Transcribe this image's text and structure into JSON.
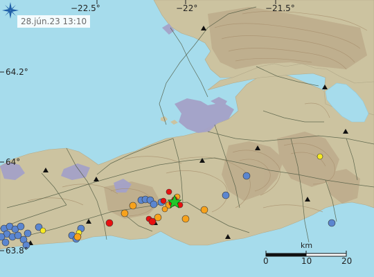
{
  "timestamp": "28.jún.23  13:10",
  "lon_labels": [
    "−22.5°",
    "−22°",
    "−21.5°"
  ],
  "lat_labels": [
    "64.2°",
    "64°",
    "63.8°"
  ],
  "scale": {
    "unit": "km",
    "ticks": [
      "0",
      "10",
      "20"
    ]
  },
  "logo_icon": "vedur-star-logo",
  "colors": {
    "sea": "#a6dcec",
    "land": "#ccc3a0",
    "lava": "#a4a2c8",
    "contour": "#a8906e",
    "road": "#4f5a42",
    "quake_last_hour": "#e81010",
    "quake_4_12h": "#f7a21c",
    "quake_12_24h": "#f7ea24",
    "quake_older": "#5b86d0",
    "largest_quake_star": "#22c82a"
  },
  "mountains": 11,
  "earthquakes": {
    "red": 8,
    "orange": 9,
    "yellow": 3,
    "blue": 24
  }
}
